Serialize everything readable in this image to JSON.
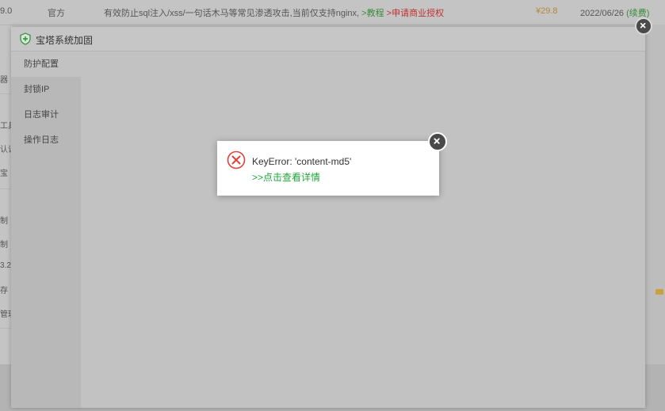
{
  "background_row": {
    "version": "9.0",
    "type": "官方",
    "description": "有效防止sql注入/xss/一句话木马等常见渗透攻击,当前仅支持nginx,",
    "tutorial_link": ">教程",
    "license_link": ">申请商业授权",
    "price": "¥29.8",
    "expiry_date": "2022/06/26",
    "renew_link": "(续费)"
  },
  "left_fragments": [
    "器",
    "工具",
    "认证",
    "宝",
    "制",
    "制",
    "3.2",
    "存",
    "管理"
  ],
  "outer_dialog": {
    "title": "宝塔系统加固",
    "sidebar": [
      "防护配置",
      "封锁IP",
      "日志审计",
      "操作日志"
    ]
  },
  "alert": {
    "message": "KeyError: 'content-md5'",
    "detail_link": ">>点击查看详情"
  },
  "colors": {
    "success_green": "#20a53a",
    "error_red": "#e0413b",
    "price_orange": "#b8863a"
  },
  "icons": {
    "dialog": "shield-icon",
    "alert": "error-circle-icon",
    "close": "close-icon"
  }
}
